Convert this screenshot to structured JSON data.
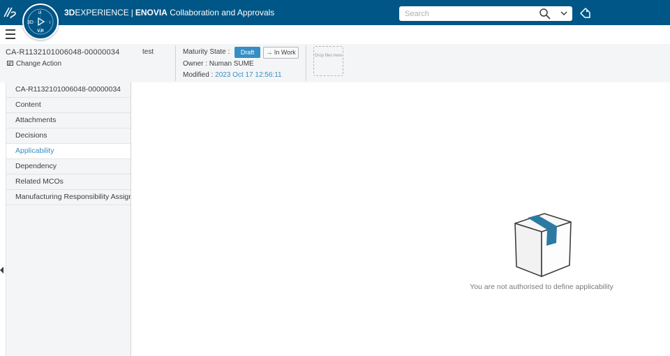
{
  "topbar": {
    "brand_bold": "3D",
    "brand_rest": "EXPERIENCE",
    "brand_sep": "|",
    "brand_app": "ENOVIA",
    "app_name": "Collaboration and Approvals",
    "compass_version": "V.R",
    "search_placeholder": "Search"
  },
  "header": {
    "object_id": "CA-R1132101006048-00000034",
    "object_type": "Change Action",
    "title": "test",
    "maturity_label": "Maturity State :",
    "state_current": "Draft",
    "state_next": "→ In Work",
    "owner_label": "Owner :",
    "owner_value": "Numan SUME",
    "modified_label": "Modified :",
    "modified_value": "2023 Oct 17 12:56:11",
    "drop_text": "Drop files here"
  },
  "sidebar": {
    "items": [
      {
        "label": "CA-R1132101006048-00000034",
        "active": false
      },
      {
        "label": "Content",
        "active": false
      },
      {
        "label": "Attachments",
        "active": false
      },
      {
        "label": "Decisions",
        "active": false
      },
      {
        "label": "Applicability",
        "active": true
      },
      {
        "label": "Dependency",
        "active": false
      },
      {
        "label": "Related MCOs",
        "active": false
      },
      {
        "label": "Manufacturing Responsibility Assignment",
        "active": false
      }
    ]
  },
  "content": {
    "empty_message": "You are not authorised to define applicability"
  },
  "colors": {
    "topbar": "#005686",
    "accent": "#368ec4"
  }
}
